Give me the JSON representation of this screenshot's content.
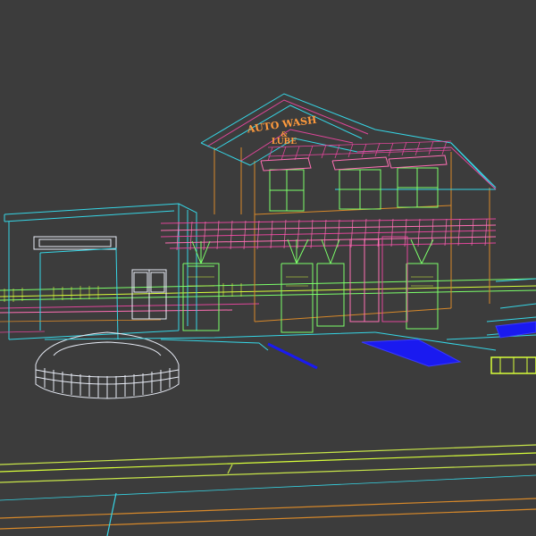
{
  "scene": {
    "sign_line1": "AUTO WASH",
    "sign_line2": "&",
    "sign_line3": "LUBE"
  },
  "colors": {
    "background": "#3c3c3c",
    "cyan": "#36d6e6",
    "magenta": "#e0469a",
    "pink": "#ff6fb4",
    "green": "#7cff6a",
    "lime": "#d8ff3a",
    "orange": "#d8892a",
    "blue": "#1a1af0",
    "white": "#e8ecf6",
    "yellow_green": "#c8e64a"
  }
}
